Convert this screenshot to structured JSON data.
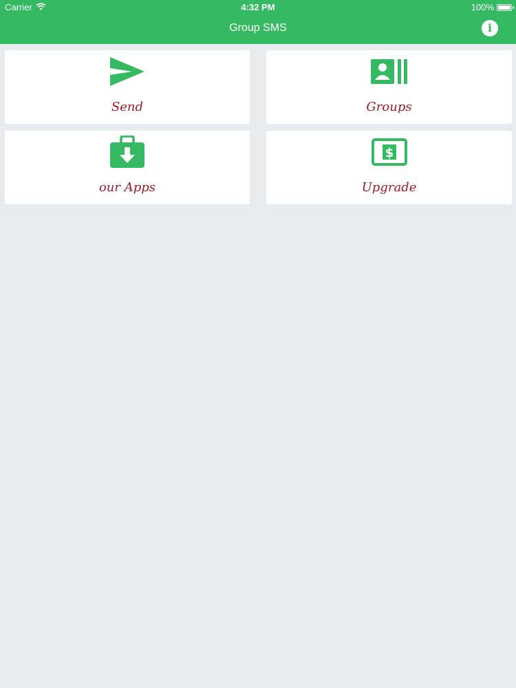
{
  "status_bar": {
    "carrier": "Carrier",
    "time": "4:32 PM",
    "battery": "100%",
    "battery_level": 1.0
  },
  "nav": {
    "title": "Group SMS",
    "info_glyph": "i"
  },
  "tiles": [
    {
      "label": "Send",
      "icon": "paper-plane-icon"
    },
    {
      "label": "Groups",
      "icon": "contact-card-icon"
    },
    {
      "label": "our Apps",
      "icon": "toolbox-download-icon"
    },
    {
      "label": "Upgrade",
      "icon": "dollar-bill-icon"
    }
  ],
  "colors": {
    "brand_green": "#35b962",
    "label_red": "#9b1b2a",
    "background": "#e9ebee",
    "tile_background": "#ffffff"
  }
}
